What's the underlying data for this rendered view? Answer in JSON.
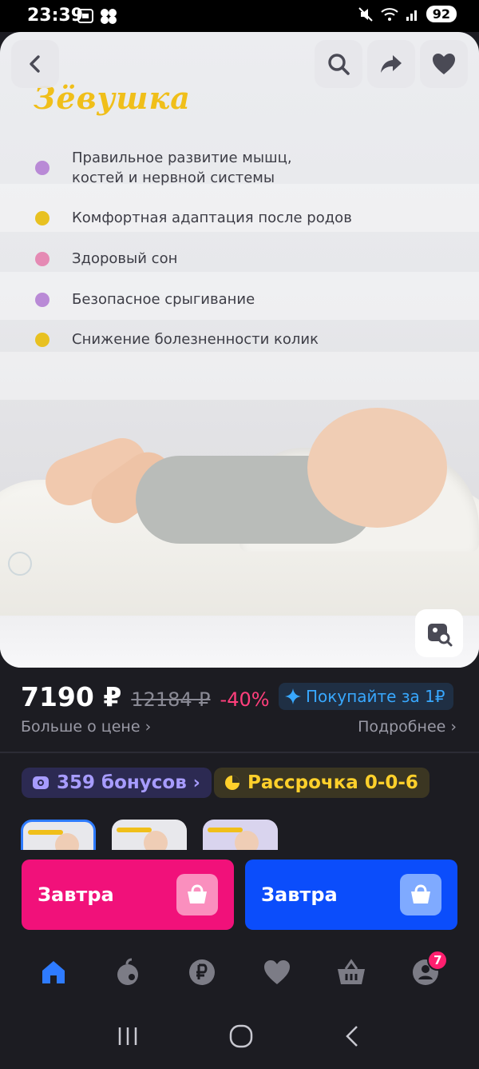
{
  "status_bar": {
    "time": "23:39",
    "battery": "92"
  },
  "hero": {
    "brand": "Зёвушка",
    "features": [
      {
        "text": "Правильное развитие мышц, костей и нервной системы",
        "color": "#b98ad6"
      },
      {
        "text": "Комфортная адаптация после родов",
        "color": "#e8c121"
      },
      {
        "text": "Здоровый сон",
        "color": "#e58ab4"
      },
      {
        "text": "Безопасное срыгивание",
        "color": "#b98ad6"
      },
      {
        "text": "Снижение болезненности колик",
        "color": "#e8c121"
      }
    ]
  },
  "price": {
    "current": "7190 ₽",
    "old": "12184 ₽",
    "discount": "-40%",
    "promo": "Покупайте за 1₽",
    "more": "Больше о цене",
    "details": "Подробнее"
  },
  "chips": {
    "bonus": "359 бонусов",
    "installment": "Рассрочка 0-0-6"
  },
  "actions": {
    "pink_label": "Завтра",
    "blue_label": "Завтра"
  },
  "nav": {
    "profile_badge": "7"
  },
  "colors": {
    "accent_pink": "#f1117a",
    "accent_blue": "#0b4dfb",
    "discount": "#ff3f7c",
    "promo_text": "#38a8ff",
    "bonus_text": "#a79cff",
    "installment_text": "#ffd02b",
    "nav_active": "#2e7bff"
  },
  "icons": [
    "back-icon",
    "search-icon",
    "share-icon",
    "heart-icon",
    "image-search-icon",
    "sparkle-icon",
    "camera-bonus-icon",
    "installment-icon",
    "basket-icon",
    "home-icon",
    "catalog-icon",
    "ruble-icon",
    "cart-icon",
    "profile-icon"
  ]
}
